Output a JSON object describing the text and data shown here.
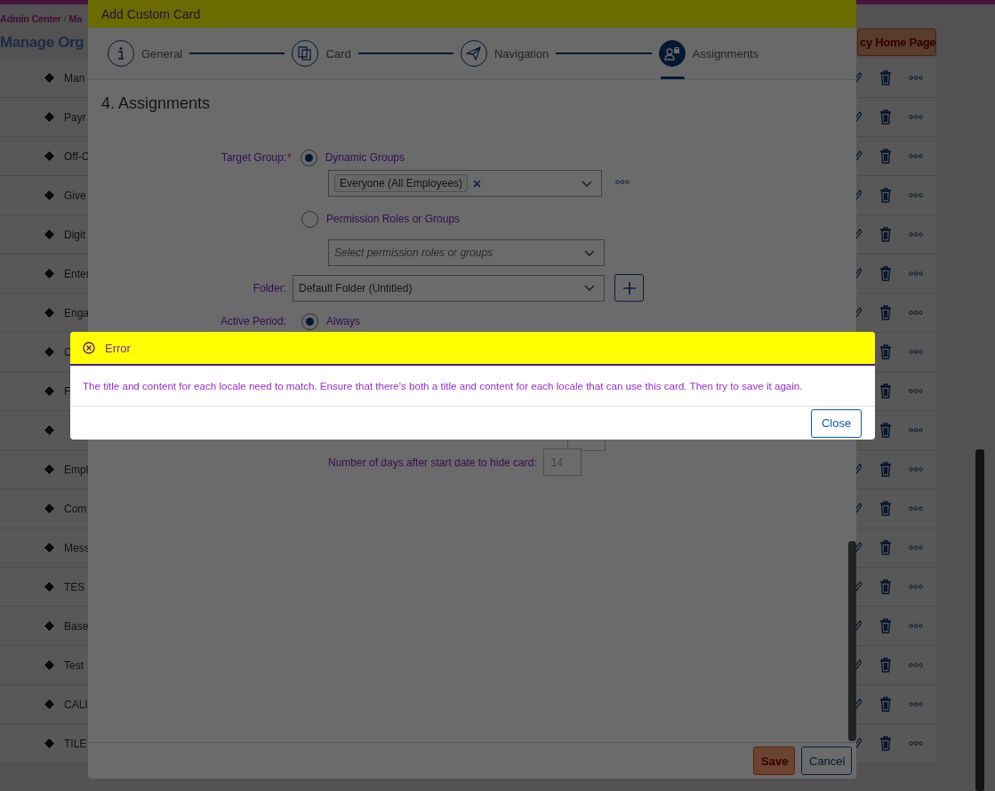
{
  "page": {
    "breadcrumb": [
      {
        "label": "Admin Center"
      },
      {
        "label": "Ma"
      }
    ],
    "breadcrumb_separator": "/",
    "title": "Manage Org",
    "header_button": "cy Home Page",
    "rows": [
      {
        "name": "Man"
      },
      {
        "name": "Payr"
      },
      {
        "name": "Off-C"
      },
      {
        "name": "Give"
      },
      {
        "name": "Digit"
      },
      {
        "name": "Enter"
      },
      {
        "name": "Enga"
      },
      {
        "name": "C"
      },
      {
        "name": "F"
      },
      {},
      {
        "name": "Empl"
      },
      {
        "name": "Com"
      },
      {
        "name": "Mess"
      },
      {
        "name": "TES"
      },
      {
        "name": "Base"
      },
      {
        "name": "Test"
      },
      {
        "name": "CALI"
      },
      {
        "name": "TILE"
      }
    ]
  },
  "dialog": {
    "title": "Add Custom Card",
    "steps": [
      {
        "label": "General",
        "selected": false
      },
      {
        "label": "Card",
        "selected": false
      },
      {
        "label": "Navigation",
        "selected": false
      },
      {
        "label": "Assignments",
        "selected": true
      }
    ],
    "section_title": "4. Assignments",
    "target_group": {
      "label": "Target Group:",
      "required_mark": "*",
      "options": [
        {
          "label": "Dynamic Groups",
          "selected": true
        },
        {
          "label": "Permission Roles or Groups",
          "selected": false
        }
      ],
      "token": "Everyone (All Employees)",
      "placeholder": "Select permission roles or groups"
    },
    "folder": {
      "label": "Folder:",
      "value": "Default Folder (Untitled)"
    },
    "active_period": {
      "label": "Active Period:",
      "option": {
        "label": "Always",
        "selected": true
      }
    },
    "hide_days": {
      "label": "Number of days after start date to hide card:",
      "value": "14"
    },
    "buttons": [
      {
        "label": "Save",
        "kind": "primary"
      },
      {
        "label": "Cancel",
        "kind": "secondary"
      }
    ]
  },
  "error": {
    "title": "Error",
    "message": "The title and content for each locale need to match. Ensure that there's both a title and content for each locale that can use this card. Then try to save it again.",
    "button": "Close"
  }
}
